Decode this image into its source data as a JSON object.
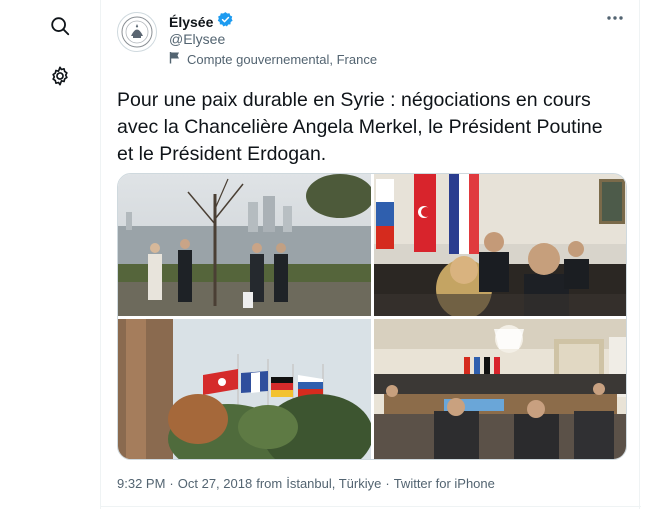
{
  "account": {
    "name": "Élysée",
    "handle": "@Elysee",
    "label": "Compte gouvernemental, France"
  },
  "tweet": {
    "text": "Pour une paix durable en Syrie : négociations en cours\navec la Chancelière Angela Merkel, le Président Poutine\net le Président Erdogan."
  },
  "meta": {
    "time": "9:32 PM",
    "date": "Oct 27, 2018",
    "from": "from",
    "location": "İstanbul, Türkiye",
    "sep": "·",
    "source": "Twitter for iPhone"
  },
  "icons": {
    "search": "search-icon",
    "settings": "gear-icon",
    "verified": "verified-badge-icon",
    "flag": "flag-icon",
    "more": "more-icon"
  },
  "colors": {
    "verified": "#1d9bf0",
    "text": "#0f1419",
    "secondary": "#536471"
  }
}
